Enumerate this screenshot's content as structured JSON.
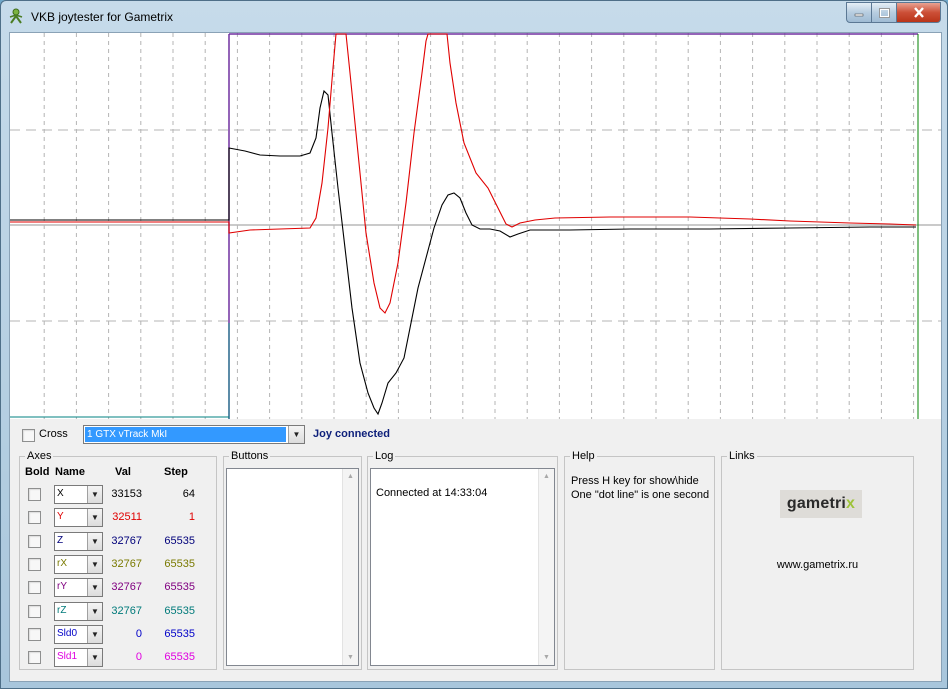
{
  "window": {
    "title": "VKB joytester for Gametrix"
  },
  "controls": {
    "cross_label": "Cross",
    "device_selected": "1 GTX vTrack MkI",
    "status": "Joy connected"
  },
  "axes": {
    "title": "Axes",
    "headers": {
      "bold": "Bold",
      "name": "Name",
      "val": "Val",
      "step": "Step"
    },
    "rows": [
      {
        "name": "X",
        "val": "33153",
        "step": "64",
        "color": "#000000"
      },
      {
        "name": "Y",
        "val": "32511",
        "step": "1",
        "color": "#e00000"
      },
      {
        "name": "Z",
        "val": "32767",
        "step": "65535",
        "color": "#00007a"
      },
      {
        "name": "rX",
        "val": "32767",
        "step": "65535",
        "color": "#7a7a00"
      },
      {
        "name": "rY",
        "val": "32767",
        "step": "65535",
        "color": "#800080"
      },
      {
        "name": "rZ",
        "val": "32767",
        "step": "65535",
        "color": "#007a7a"
      },
      {
        "name": "Sld0",
        "val": "0",
        "step": "65535",
        "color": "#0000c8"
      },
      {
        "name": "Sld1",
        "val": "0",
        "step": "65535",
        "color": "#e000e0"
      }
    ]
  },
  "buttons_group": {
    "title": "Buttons"
  },
  "log_group": {
    "title": "Log",
    "entries": [
      "Connected at 14:33:04"
    ]
  },
  "help_group": {
    "title": "Help",
    "lines": [
      "Press H key for show\\hide",
      "One \"dot line\" is one second"
    ]
  },
  "links_group": {
    "title": "Links",
    "logo_text_main": "gametri",
    "logo_text_accent": "x",
    "url": "www.gametrix.ru"
  },
  "colors": {
    "x_series": "#000000",
    "y_series": "#e00000",
    "grid": "#b4b4b4",
    "center_line": "#b8b8b8",
    "marker_start": "#7030a0",
    "marker_end": "#008000",
    "selection": "#3399ff"
  }
}
